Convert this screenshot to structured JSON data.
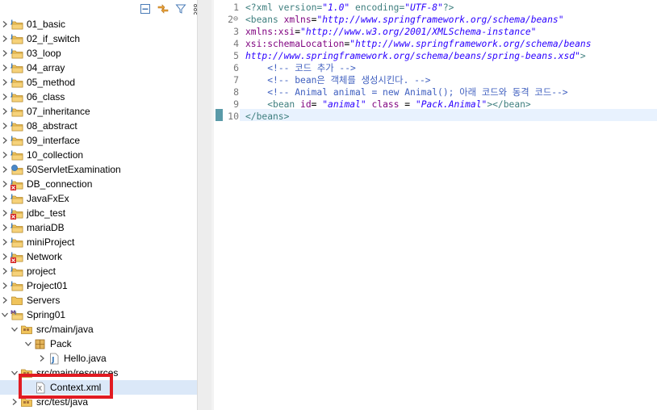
{
  "explorer": {
    "toolbar": [
      {
        "name": "collapse-all-icon"
      },
      {
        "name": "link-with-editor-icon"
      },
      {
        "name": "filter-icon"
      },
      {
        "name": "view-menu-icon"
      }
    ],
    "items": [
      {
        "label": "01_basic",
        "level": 0,
        "chevron": "right",
        "icon": "project-icon",
        "error": false
      },
      {
        "label": "02_if_switch",
        "level": 0,
        "chevron": "right",
        "icon": "project-icon",
        "error": false
      },
      {
        "label": "03_loop",
        "level": 0,
        "chevron": "right",
        "icon": "project-icon",
        "error": false
      },
      {
        "label": "04_array",
        "level": 0,
        "chevron": "right",
        "icon": "project-icon",
        "error": false
      },
      {
        "label": "05_method",
        "level": 0,
        "chevron": "right",
        "icon": "project-icon",
        "error": false
      },
      {
        "label": "06_class",
        "level": 0,
        "chevron": "right",
        "icon": "project-icon",
        "error": false
      },
      {
        "label": "07_inheritance",
        "level": 0,
        "chevron": "right",
        "icon": "project-icon",
        "error": false
      },
      {
        "label": "08_abstract",
        "level": 0,
        "chevron": "right",
        "icon": "project-icon",
        "error": false
      },
      {
        "label": "09_interface",
        "level": 0,
        "chevron": "right",
        "icon": "project-icon",
        "error": false
      },
      {
        "label": "10_collection",
        "level": 0,
        "chevron": "right",
        "icon": "project-icon",
        "error": false
      },
      {
        "label": "50ServletExamination",
        "level": 0,
        "chevron": "right",
        "icon": "web-project-icon",
        "error": false
      },
      {
        "label": "DB_connection",
        "level": 0,
        "chevron": "right",
        "icon": "project-icon",
        "error": true
      },
      {
        "label": "JavaFxEx",
        "level": 0,
        "chevron": "right",
        "icon": "project-icon",
        "error": false
      },
      {
        "label": "jdbc_test",
        "level": 0,
        "chevron": "right",
        "icon": "project-icon",
        "error": true
      },
      {
        "label": "mariaDB",
        "level": 0,
        "chevron": "right",
        "icon": "project-icon",
        "error": false
      },
      {
        "label": "miniProject",
        "level": 0,
        "chevron": "right",
        "icon": "project-icon",
        "error": false
      },
      {
        "label": "Network",
        "level": 0,
        "chevron": "right",
        "icon": "project-icon",
        "error": true
      },
      {
        "label": "project",
        "level": 0,
        "chevron": "right",
        "icon": "project-icon",
        "error": false
      },
      {
        "label": "Project01",
        "level": 0,
        "chevron": "right",
        "icon": "project-icon",
        "error": false
      },
      {
        "label": "Servers",
        "level": 0,
        "chevron": "right",
        "icon": "folder-icon",
        "error": false
      },
      {
        "label": "Spring01",
        "level": 0,
        "chevron": "down",
        "icon": "maven-project-icon",
        "error": false
      },
      {
        "label": "src/main/java",
        "level": 1,
        "chevron": "down",
        "icon": "source-folder-icon",
        "error": false
      },
      {
        "label": "Pack",
        "level": 2,
        "chevron": "down",
        "icon": "package-icon",
        "error": false
      },
      {
        "label": "Hello.java",
        "level": 3,
        "chevron": "right",
        "icon": "java-file-icon",
        "error": false
      },
      {
        "label": "src/main/resources",
        "level": 1,
        "chevron": "down",
        "icon": "source-folder-icon",
        "error": false
      },
      {
        "label": "Context.xml",
        "level": 2,
        "chevron": "none",
        "icon": "xml-file-icon",
        "error": false,
        "selected": true
      },
      {
        "label": "src/test/java",
        "level": 1,
        "chevron": "right",
        "icon": "source-folder-icon",
        "error": false
      }
    ]
  },
  "editor": {
    "line_numbers": [
      "1",
      "2",
      "3",
      "4",
      "5",
      "6",
      "7",
      "8",
      "9",
      "10"
    ],
    "fold_marker": "⊖",
    "lines": [
      [
        {
          "t": "<?xml version=",
          "c": "pi"
        },
        {
          "t": "\"1.0\"",
          "c": "val"
        },
        {
          "t": " encoding=",
          "c": "pi"
        },
        {
          "t": "\"UTF-8\"",
          "c": "val"
        },
        {
          "t": "?>",
          "c": "pi"
        }
      ],
      [
        {
          "t": "<beans ",
          "c": "tag"
        },
        {
          "t": "xmlns",
          "c": "attr"
        },
        {
          "t": "=",
          "c": "txt"
        },
        {
          "t": "\"http://www.springframework.org/schema/beans\"",
          "c": "val"
        }
      ],
      [
        {
          "t": "xmlns:xsi",
          "c": "attr"
        },
        {
          "t": "=",
          "c": "txt"
        },
        {
          "t": "\"http://www.w3.org/2001/XMLSchema-instance\"",
          "c": "val"
        }
      ],
      [
        {
          "t": "xsi:schemaLocation",
          "c": "attr"
        },
        {
          "t": "=",
          "c": "txt"
        },
        {
          "t": "\"http://www.springframework.org/schema/beans",
          "c": "val"
        }
      ],
      [
        {
          "t": "http://www.springframework.org/schema/beans/spring-beans.xsd\"",
          "c": "val"
        },
        {
          "t": ">",
          "c": "tag"
        }
      ],
      [
        {
          "t": "    ",
          "c": "txt"
        },
        {
          "t": "<!-- 코드 추가 -->",
          "c": "com"
        }
      ],
      [
        {
          "t": "    ",
          "c": "txt"
        },
        {
          "t": "<!-- bean은 객체를 생성시킨다. -->",
          "c": "com"
        }
      ],
      [
        {
          "t": "    ",
          "c": "txt"
        },
        {
          "t": "<!-- Animal animal = new Animal(); 아래 코드와 동격 코드-->",
          "c": "com"
        }
      ],
      [
        {
          "t": "    ",
          "c": "txt"
        },
        {
          "t": "<bean ",
          "c": "tag"
        },
        {
          "t": "id",
          "c": "attr"
        },
        {
          "t": "= ",
          "c": "txt"
        },
        {
          "t": "\"animal\"",
          "c": "val"
        },
        {
          "t": " ",
          "c": "txt"
        },
        {
          "t": "class",
          "c": "attr"
        },
        {
          "t": " = ",
          "c": "txt"
        },
        {
          "t": "\"Pack.Animal\"",
          "c": "val"
        },
        {
          "t": "></bean>",
          "c": "tag"
        }
      ],
      [
        {
          "t": "</beans>",
          "c": "tag"
        }
      ]
    ]
  }
}
